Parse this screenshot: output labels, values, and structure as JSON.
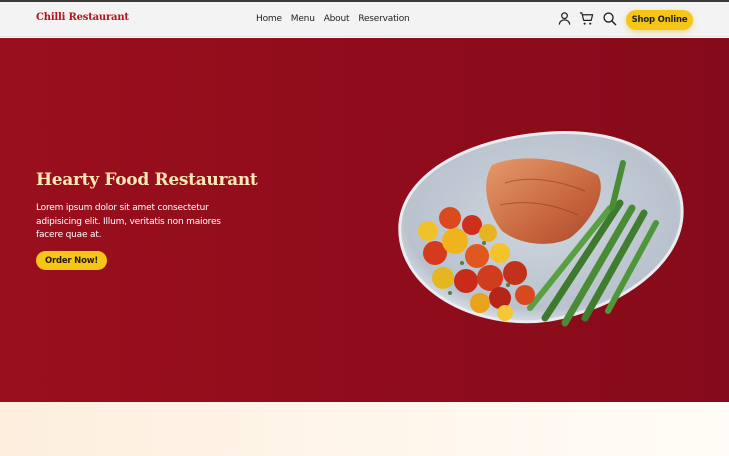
{
  "header": {
    "brand": "Chilli Restaurant",
    "nav": [
      "Home",
      "Menu",
      "About",
      "Reservation"
    ],
    "icons": [
      "user-icon",
      "cart-icon",
      "search-icon"
    ],
    "shop_button": "Shop Online"
  },
  "hero": {
    "title": "Hearty Food Restaurant",
    "text": "Lorem ipsum dolor sit amet consectetur adipisicing elit. Illum, veritatis non maiores facere quae at.",
    "order_button": "Order Now!",
    "image": "salmon-with-tomatoes-and-asparagus-plate"
  },
  "colors": {
    "brand": "#b3131d",
    "hero_bg": "#8f0c1c",
    "accent": "#f5c518",
    "title": "#fde9b4"
  }
}
